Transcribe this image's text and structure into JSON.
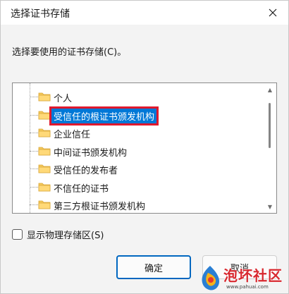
{
  "window": {
    "title": "选择证书存储",
    "close_icon": "close-icon"
  },
  "prompt": "选择要使用的证书存储(C)。",
  "tree": {
    "items": [
      {
        "label": "个人",
        "selected": false
      },
      {
        "label": "受信任的根证书颁发机构",
        "selected": true
      },
      {
        "label": "企业信任",
        "selected": false
      },
      {
        "label": "中间证书颁发机构",
        "selected": false
      },
      {
        "label": "受信任的发布者",
        "selected": false
      },
      {
        "label": "不信任的证书",
        "selected": false
      },
      {
        "label": "第三方根证书颁发机构",
        "selected": false
      }
    ],
    "icon": "folder-icon"
  },
  "scrollbar": {
    "up_icon": "scroll-up-icon",
    "down_icon": "scroll-down-icon"
  },
  "checkbox": {
    "label": "显示物理存储区(S)",
    "checked": false
  },
  "buttons": {
    "ok_label": "确定",
    "cancel_label": "取消"
  },
  "watermark": {
    "text": "泡坏社区",
    "url": "www.pahuai.com"
  },
  "colors": {
    "selection": "#0078d7",
    "highlight_border": "#e0182d",
    "folder": "#f4c85a",
    "primary_button_border": "#0067c0"
  }
}
